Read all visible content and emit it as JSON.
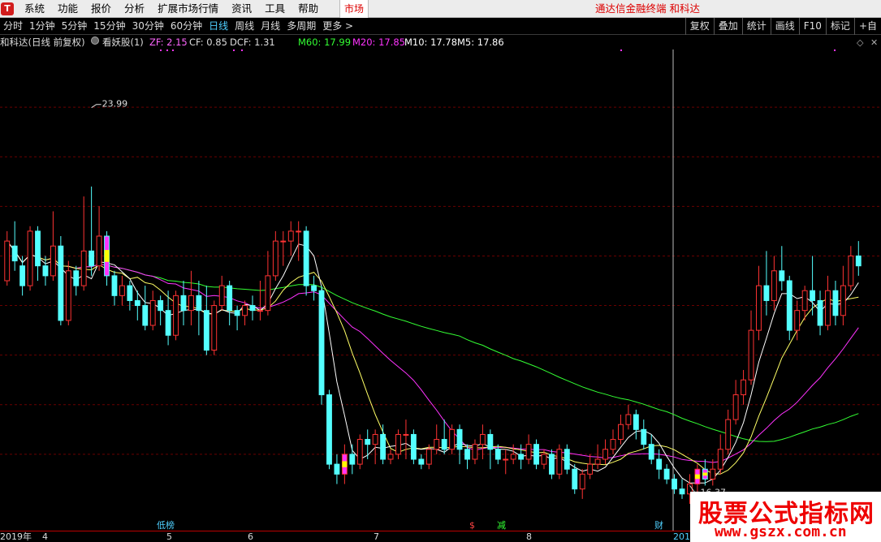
{
  "menubar": {
    "logo": "T",
    "items": [
      "系统",
      "功能",
      "报价",
      "分析",
      "扩展市场行情",
      "资讯",
      "工具",
      "帮助"
    ],
    "market_tab": "市场",
    "brand": "通达信金融终端  和科达"
  },
  "toolbar": {
    "periods": [
      "分时",
      "1分钟",
      "5分钟",
      "15分钟",
      "30分钟",
      "60分钟",
      "日线",
      "周线",
      "月线",
      "多周期",
      "更多 >"
    ],
    "active_period": "日线",
    "tools": [
      "复权",
      "叠加",
      "统计",
      "画线",
      "F10",
      "标记",
      "+自"
    ]
  },
  "infobar": {
    "title": "和科达(日线 前复权)",
    "indicator_icon": "settings-icon",
    "indicator_name": "看妖股(1)",
    "zf": "ZF: 2.15",
    "cf": "CF: 0.85",
    "dcf": "DCF: 1.31",
    "m60": "M60: 17.99",
    "m20": "M20: 17.85",
    "m10": "M10: 17.78",
    "m5": "M5: 17.86"
  },
  "annotations": {
    "high": "23.99",
    "low": "16.37"
  },
  "events": [
    "低榜",
    "$",
    "减",
    "财"
  ],
  "axis": {
    "year_start": "2019年",
    "months": [
      "4",
      "5",
      "6",
      "7",
      "8"
    ],
    "year_end": "2019"
  },
  "colors": {
    "up": "#ff3333",
    "down": "#54ffff",
    "m5": "#ffffff",
    "m10": "#ffff66",
    "m20": "#ff33ff",
    "m60": "#33ff33",
    "grid": "#6a0000",
    "highlight_magenta": "#ff33ff",
    "highlight_yellow": "#ffff00"
  },
  "chart_data": {
    "type": "candlestick",
    "title": "和科达(日线 前复权)",
    "price_range": [
      16.0,
      25.0
    ],
    "annotated_high": 23.99,
    "annotated_low": 16.37,
    "moving_averages": {
      "M5": 17.86,
      "M10": 17.78,
      "M20": 17.85,
      "M60": 17.99
    },
    "candles": [
      [
        20.5,
        21.3,
        20.4,
        21.5
      ],
      [
        21.2,
        20.9,
        20.7,
        21.7
      ],
      [
        20.8,
        20.4,
        20.2,
        21.0
      ],
      [
        20.4,
        21.5,
        20.3,
        21.6
      ],
      [
        21.5,
        20.8,
        20.5,
        21.6
      ],
      [
        20.8,
        20.6,
        20.4,
        21.0
      ],
      [
        20.6,
        21.2,
        20.5,
        21.9
      ],
      [
        21.2,
        19.7,
        19.6,
        21.4
      ],
      [
        19.7,
        20.7,
        19.6,
        20.9
      ],
      [
        20.7,
        20.4,
        20.2,
        20.8
      ],
      [
        20.4,
        21.1,
        20.3,
        22.2
      ],
      [
        21.1,
        20.8,
        20.6,
        22.4
      ],
      [
        20.8,
        21.4,
        20.7,
        22.0
      ],
      [
        21.4,
        20.6,
        20.4,
        21.5
      ],
      [
        20.6,
        20.2,
        20.0,
        20.7
      ],
      [
        20.2,
        20.4,
        20.0,
        20.6
      ],
      [
        20.4,
        20.1,
        19.9,
        20.5
      ],
      [
        20.1,
        20.0,
        19.7,
        20.3
      ],
      [
        20.0,
        19.6,
        19.5,
        20.4
      ],
      [
        19.6,
        20.1,
        19.5,
        20.3
      ],
      [
        20.1,
        19.9,
        19.6,
        20.2
      ],
      [
        19.9,
        19.4,
        19.2,
        20.3
      ],
      [
        19.4,
        20.2,
        19.3,
        20.3
      ],
      [
        20.2,
        19.9,
        19.6,
        20.5
      ],
      [
        19.9,
        20.2,
        19.6,
        20.7
      ],
      [
        20.2,
        19.9,
        19.4,
        20.5
      ],
      [
        19.9,
        19.1,
        19.0,
        20.4
      ],
      [
        19.1,
        20.0,
        19.0,
        20.1
      ],
      [
        20.0,
        20.4,
        19.9,
        20.6
      ],
      [
        20.4,
        19.9,
        19.6,
        20.5
      ],
      [
        19.9,
        19.8,
        19.5,
        20.0
      ],
      [
        19.8,
        20.0,
        19.6,
        20.1
      ],
      [
        20.0,
        19.9,
        19.7,
        20.2
      ],
      [
        19.9,
        19.9,
        19.7,
        20.5
      ],
      [
        19.9,
        20.6,
        19.8,
        21.1
      ],
      [
        20.6,
        21.3,
        20.5,
        21.5
      ],
      [
        21.3,
        21.3,
        20.8,
        21.5
      ],
      [
        21.3,
        21.5,
        21.0,
        21.7
      ],
      [
        21.5,
        21.5,
        20.9,
        21.7
      ],
      [
        21.5,
        20.4,
        20.2,
        21.6
      ],
      [
        20.4,
        20.3,
        20.1,
        20.6
      ],
      [
        20.3,
        18.2,
        18.0,
        20.4
      ],
      [
        18.2,
        16.8,
        16.7,
        18.3
      ],
      [
        16.8,
        16.6,
        16.4,
        17.0
      ],
      [
        16.6,
        17.0,
        16.4,
        17.2
      ],
      [
        17.0,
        16.8,
        16.6,
        17.2
      ],
      [
        16.8,
        17.3,
        16.7,
        17.4
      ],
      [
        17.3,
        17.2,
        16.9,
        17.5
      ],
      [
        17.2,
        17.4,
        16.8,
        17.5
      ],
      [
        17.4,
        16.9,
        16.8,
        17.6
      ],
      [
        16.9,
        17.0,
        16.8,
        17.1
      ],
      [
        17.0,
        17.4,
        16.9,
        17.5
      ],
      [
        17.4,
        17.4,
        16.9,
        17.7
      ],
      [
        17.4,
        16.9,
        16.8,
        17.5
      ],
      [
        16.9,
        16.8,
        16.7,
        17.0
      ],
      [
        16.8,
        17.1,
        16.7,
        17.2
      ],
      [
        17.1,
        17.3,
        17.0,
        17.6
      ],
      [
        17.3,
        17.1,
        17.0,
        17.7
      ],
      [
        17.1,
        17.5,
        17.0,
        17.6
      ],
      [
        17.5,
        17.1,
        16.8,
        17.6
      ],
      [
        17.1,
        16.9,
        16.7,
        17.2
      ],
      [
        16.9,
        17.2,
        16.8,
        17.3
      ],
      [
        17.2,
        17.4,
        16.9,
        17.6
      ],
      [
        17.4,
        17.1,
        16.7,
        17.5
      ],
      [
        17.1,
        16.9,
        16.8,
        17.2
      ],
      [
        16.9,
        16.9,
        16.6,
        17.1
      ],
      [
        16.9,
        17.0,
        16.8,
        17.2
      ],
      [
        17.0,
        16.9,
        16.7,
        17.2
      ],
      [
        16.9,
        17.2,
        16.8,
        17.4
      ],
      [
        17.2,
        16.8,
        16.7,
        17.3
      ],
      [
        16.8,
        17.0,
        16.7,
        17.1
      ],
      [
        17.0,
        16.6,
        16.5,
        17.1
      ],
      [
        16.6,
        17.1,
        16.5,
        17.2
      ],
      [
        17.1,
        16.7,
        16.6,
        17.2
      ],
      [
        16.7,
        16.3,
        16.2,
        16.8
      ],
      [
        16.3,
        16.6,
        16.1,
        16.7
      ],
      [
        16.6,
        16.8,
        16.5,
        17.0
      ],
      [
        16.8,
        16.9,
        16.7,
        17.2
      ],
      [
        16.9,
        17.1,
        16.8,
        17.3
      ],
      [
        17.1,
        17.3,
        17.0,
        17.5
      ],
      [
        17.3,
        17.6,
        17.2,
        17.8
      ],
      [
        17.6,
        17.8,
        17.5,
        18.0
      ],
      [
        17.8,
        17.5,
        17.3,
        17.9
      ],
      [
        17.5,
        17.2,
        17.1,
        17.7
      ],
      [
        17.2,
        16.9,
        16.8,
        17.4
      ],
      [
        16.9,
        16.7,
        16.5,
        17.1
      ],
      [
        16.7,
        16.5,
        16.4,
        16.8
      ],
      [
        16.5,
        16.3,
        16.2,
        16.6
      ],
      [
        16.3,
        16.2,
        16.1,
        16.5
      ],
      [
        16.2,
        16.4,
        16.0,
        16.6
      ],
      [
        16.4,
        16.7,
        16.2,
        16.8
      ],
      [
        16.7,
        16.5,
        16.37,
        16.9
      ],
      [
        16.5,
        16.7,
        16.37,
        16.9
      ],
      [
        16.7,
        17.1,
        16.6,
        17.4
      ],
      [
        17.1,
        17.7,
        17.0,
        17.9
      ],
      [
        17.7,
        18.2,
        17.6,
        18.5
      ],
      [
        18.2,
        18.5,
        18.0,
        18.7
      ],
      [
        18.5,
        19.5,
        18.4,
        19.9
      ],
      [
        19.5,
        20.4,
        19.3,
        20.8
      ],
      [
        20.4,
        20.1,
        19.8,
        21.1
      ],
      [
        20.1,
        20.7,
        19.9,
        21.0
      ],
      [
        20.7,
        20.5,
        20.3,
        21.2
      ],
      [
        20.5,
        19.5,
        19.3,
        20.6
      ],
      [
        19.5,
        19.9,
        19.3,
        20.1
      ],
      [
        19.9,
        20.3,
        19.7,
        20.4
      ],
      [
        20.3,
        20.1,
        19.8,
        21.0
      ],
      [
        20.1,
        19.6,
        19.4,
        20.3
      ],
      [
        19.6,
        20.3,
        19.5,
        20.6
      ],
      [
        20.3,
        19.8,
        19.6,
        20.5
      ],
      [
        19.8,
        20.4,
        19.6,
        20.8
      ],
      [
        20.4,
        21.0,
        20.3,
        21.2
      ],
      [
        21.0,
        20.8,
        20.6,
        21.3
      ]
    ]
  }
}
